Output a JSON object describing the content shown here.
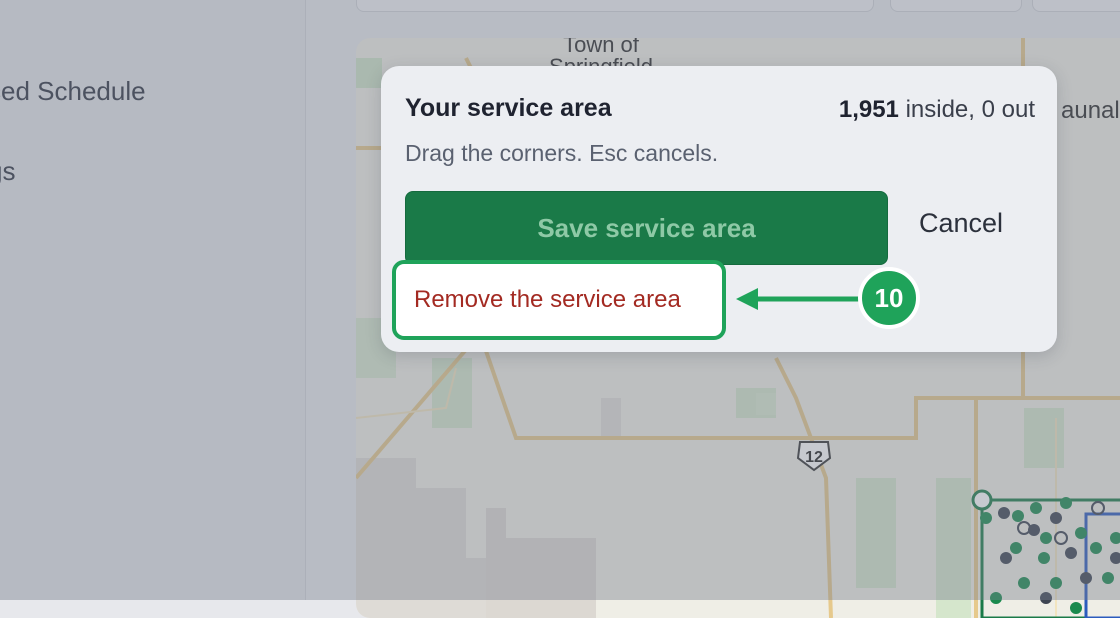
{
  "sidebar": {
    "items": [
      {
        "label": "ced Schedule"
      },
      {
        "label": "gs"
      }
    ]
  },
  "map": {
    "labels": {
      "town_line1": "Town of",
      "town_line2": "Springfield",
      "place_right": "aunal",
      "route_shield": "12"
    }
  },
  "modal": {
    "title": "Your service area",
    "count_value": "1,951",
    "count_suffix": " inside, 0 out",
    "subtitle": "Drag the corners. Esc cancels.",
    "save_label": "Save service area",
    "cancel_label": "Cancel",
    "remove_label": "Remove the service area"
  },
  "annotation": {
    "step_number": "10",
    "accent_color": "#1fa35a"
  }
}
